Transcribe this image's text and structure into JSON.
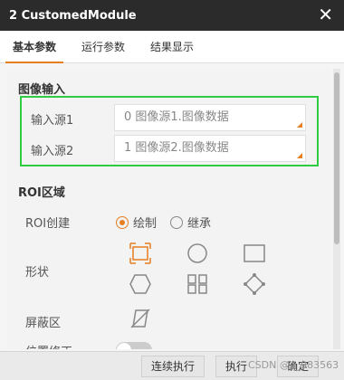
{
  "window": {
    "title": "2 CustomedModule",
    "close_icon": "close-icon"
  },
  "tabs": [
    {
      "label": "基本参数",
      "active": true
    },
    {
      "label": "运行参数",
      "active": false
    },
    {
      "label": "结果显示",
      "active": false
    }
  ],
  "image_input": {
    "section_title": "图像输入",
    "rows": [
      {
        "label": "输入源1",
        "value": "0 图像源1.图像数据"
      },
      {
        "label": "输入源2",
        "value": "1 图像源2.图像数据"
      }
    ]
  },
  "roi": {
    "section_title": "ROI区域",
    "create_label": "ROI创建",
    "options": [
      {
        "label": "绘制",
        "checked": true
      },
      {
        "label": "继承",
        "checked": false
      }
    ],
    "shape_label": "形状",
    "shapes": [
      "rect-select-icon",
      "circle-icon",
      "rectangle-icon",
      "hexagon-icon",
      "grid-icon",
      "polygon-icon"
    ],
    "mask_label": "屏蔽区",
    "mask_icon": "mask-polygon-icon",
    "position_label": "位置修正"
  },
  "footer": {
    "continuous_label": "连续执行",
    "execute_label": "执行",
    "confirm_label": "确定",
    "watermark": "CSDN @a_983563"
  },
  "colors": {
    "accent": "#e67e22",
    "highlight_border": "#2ecc40",
    "titlebar": "#2b2b2b"
  }
}
